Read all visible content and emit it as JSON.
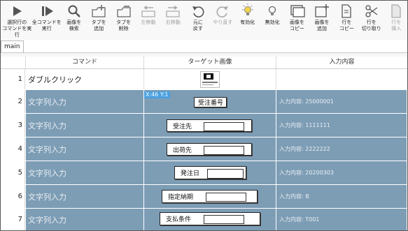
{
  "toolbar": {
    "items": [
      {
        "label": "選択行の\nコマンドを実行",
        "icon": "play-icon"
      },
      {
        "label": "全コマンドを\n実行",
        "icon": "play-all-icon"
      },
      {
        "label": "画像を\n検索",
        "icon": "search-icon"
      },
      {
        "label": "タブを\n追加",
        "icon": "add-tab-icon"
      },
      {
        "label": "タブを\n削除",
        "icon": "delete-tab-icon"
      },
      {
        "label": "左移動",
        "icon": "move-left-icon",
        "disabled": true
      },
      {
        "label": "右移動",
        "icon": "move-right-icon",
        "disabled": true
      },
      {
        "label": "元に\n戻す",
        "icon": "undo-icon"
      },
      {
        "label": "やり直す",
        "icon": "redo-icon",
        "disabled": true
      },
      {
        "label": "有効化",
        "icon": "enable-icon"
      },
      {
        "label": "無効化",
        "icon": "disable-icon"
      },
      {
        "label": "画像を\nコピー",
        "icon": "copy-image-icon"
      },
      {
        "label": "画像を\n追加",
        "icon": "add-image-icon"
      },
      {
        "label": "行を\nコピー",
        "icon": "copy-row-icon"
      },
      {
        "label": "行を\n切り取り",
        "icon": "cut-icon"
      },
      {
        "label": "行を\n挿入",
        "icon": "insert-row-icon",
        "disabled": true
      }
    ]
  },
  "tabs": [
    {
      "label": "main"
    }
  ],
  "grid": {
    "headers": {
      "command": "コマンド",
      "target_image": "ターゲット画像",
      "input": "入力内容"
    },
    "coord_tooltip": "X:46 Y:1",
    "rows": [
      {
        "num": "1",
        "command": "ダブルクリック",
        "image_label": "",
        "input": ""
      },
      {
        "num": "2",
        "command": "文字列入力",
        "image_label": "受注番号",
        "input": "入力内容: 25000001"
      },
      {
        "num": "3",
        "command": "文字列入力",
        "image_label": "受注先",
        "input": "入力内容: 1111111"
      },
      {
        "num": "4",
        "command": "文字列入力",
        "image_label": "出荷先",
        "input": "入力内容: 2222222"
      },
      {
        "num": "5",
        "command": "文字列入力",
        "image_label": "発注日",
        "input": "入力内容: 20200303"
      },
      {
        "num": "6",
        "command": "文字列入力",
        "image_label": "指定納期",
        "input": "入力内容: B"
      },
      {
        "num": "7",
        "command": "文字列入力",
        "image_label": "支払条件",
        "input": "入力内容: T001"
      }
    ]
  },
  "colors": {
    "selection": "#7d9db5",
    "tooltip": "#4aa0e0"
  }
}
